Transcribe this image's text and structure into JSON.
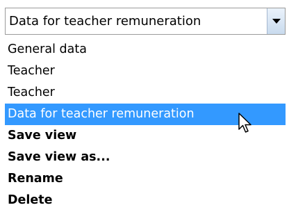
{
  "combo": {
    "value": "Data for teacher remuneration",
    "arrow_icon": "chevron-down-icon"
  },
  "options": [
    {
      "label": "General data"
    },
    {
      "label": "Teacher"
    },
    {
      "label": "Teacher"
    },
    {
      "label": "Data for teacher remuneration",
      "selected": true
    }
  ],
  "actions": [
    {
      "label": "Save view"
    },
    {
      "label": "Save view as..."
    },
    {
      "label": "Rename"
    },
    {
      "label": "Delete"
    }
  ],
  "colors": {
    "selection": "#3399ff",
    "selection_text": "#ffffff"
  },
  "cursor_icon": "mouse-pointer-icon"
}
